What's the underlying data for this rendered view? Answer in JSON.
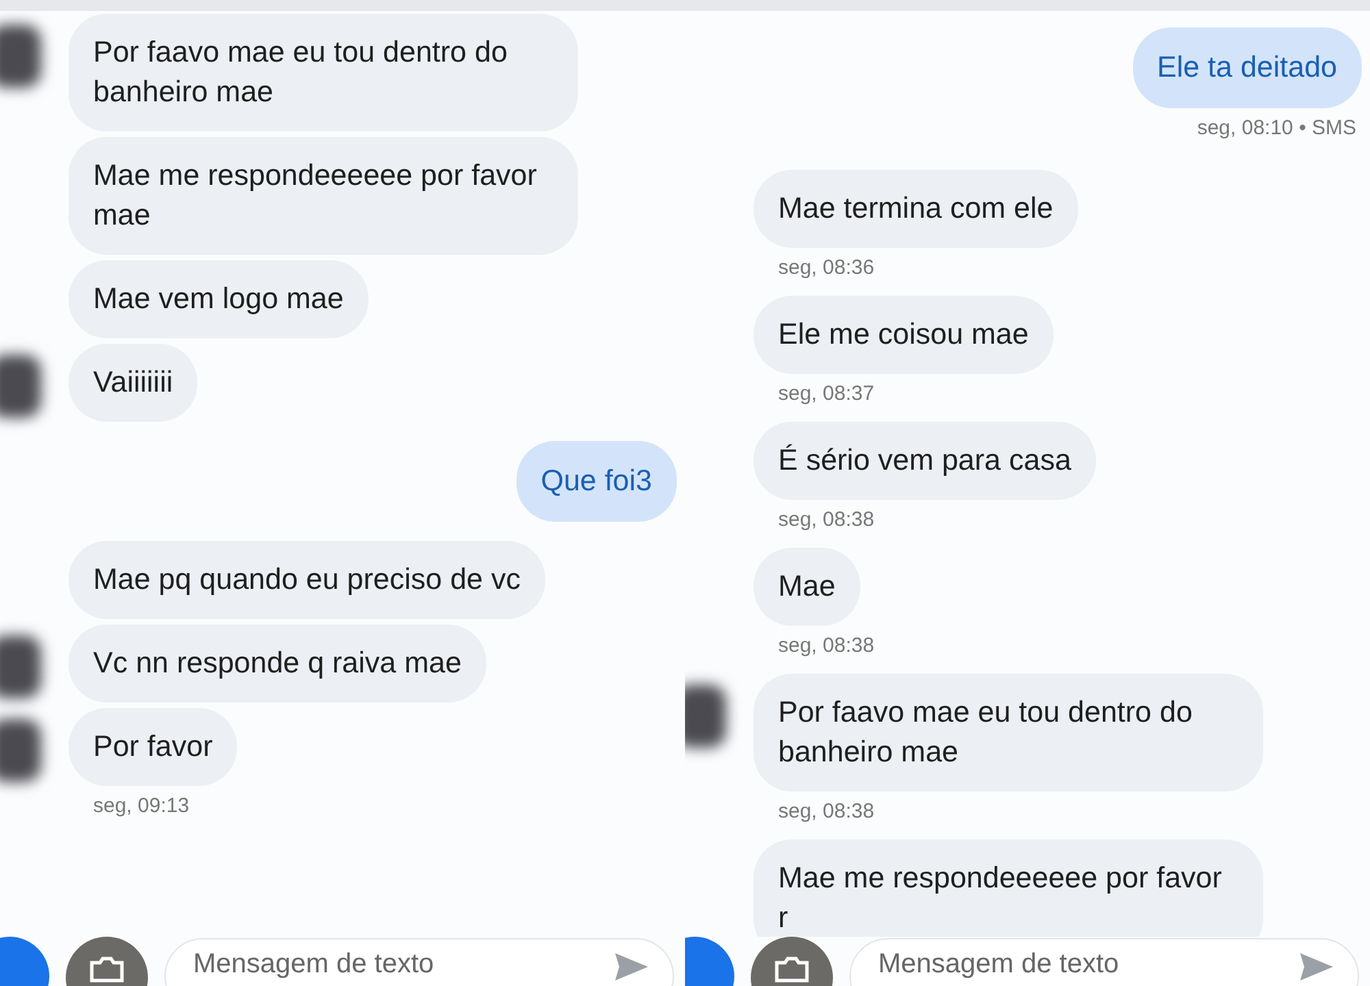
{
  "panels": [
    {
      "messages": [
        {
          "kind": "incoming",
          "text": "Por faavo mae eu tou dentro do banheiro mae",
          "avatar": true
        },
        {
          "kind": "incoming",
          "text": "Mae me respondeeeeee por favor mae",
          "avatar": false
        },
        {
          "kind": "incoming",
          "text": "Mae vem logo mae",
          "avatar": false
        },
        {
          "kind": "incoming",
          "text": "Vaiiiiiii",
          "avatar": true
        },
        {
          "kind": "outgoing",
          "text": "Que foi3",
          "avatar": false
        },
        {
          "kind": "incoming",
          "text": "Mae pq quando eu preciso de vc",
          "avatar": false
        },
        {
          "kind": "incoming",
          "text": "Vc nn responde q raiva mae",
          "avatar": true
        },
        {
          "kind": "incoming",
          "text": "Por favor",
          "avatar": true,
          "timestamp": "seg, 09:13"
        }
      ],
      "compose": {
        "placeholder": "Mensagem de texto"
      }
    },
    {
      "messages": [
        {
          "kind": "outgoing",
          "text": "Ele ta deitado",
          "avatar": false,
          "timestamp": "seg, 08:10 • SMS"
        },
        {
          "kind": "incoming",
          "text": "Mae termina com ele",
          "avatar": false,
          "timestamp": "seg, 08:36"
        },
        {
          "kind": "incoming",
          "text": "Ele me coisou mae",
          "avatar": false,
          "timestamp": "seg, 08:37"
        },
        {
          "kind": "incoming",
          "text": "É sério vem para casa",
          "avatar": false,
          "timestamp": "seg, 08:38"
        },
        {
          "kind": "incoming",
          "text": "Mae",
          "avatar": false,
          "timestamp": "seg, 08:38"
        },
        {
          "kind": "incoming",
          "text": "Por faavo mae eu tou dentro do banheiro mae",
          "avatar": true,
          "timestamp": "seg, 08:38"
        },
        {
          "kind": "incoming",
          "text": "Mae me respondeeeeee por favor r",
          "avatar": false
        }
      ],
      "compose": {
        "placeholder": "Mensagem de texto"
      }
    }
  ]
}
